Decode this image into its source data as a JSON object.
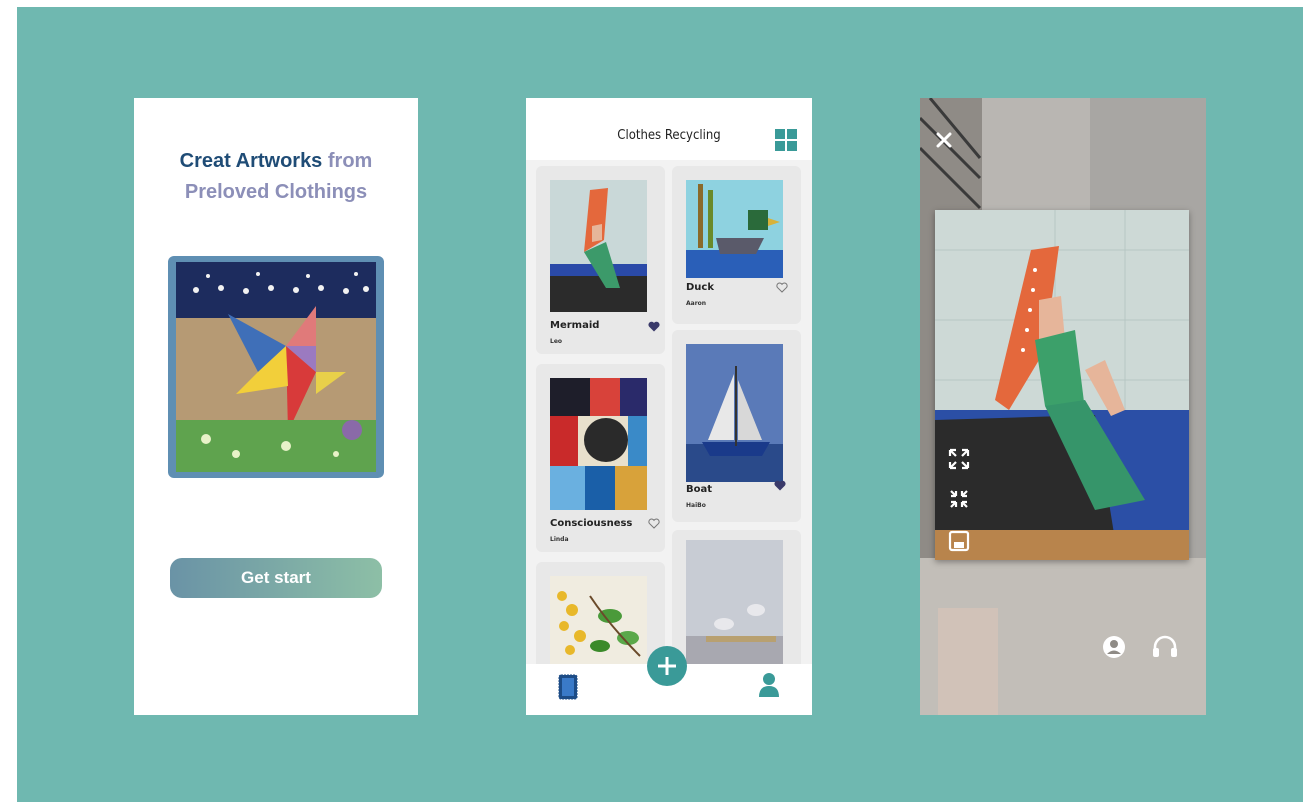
{
  "onboarding": {
    "headline_part1": "Creat Artworks",
    "headline_part2": "from",
    "headline_line2": "Preloved Clothings",
    "cta_label": "Get start"
  },
  "gallery": {
    "title": "Clothes Recycling",
    "cards": [
      {
        "title": "Mermaid",
        "author": "Leo",
        "liked": true
      },
      {
        "title": "Duck",
        "author": "Aaron",
        "liked": false
      },
      {
        "title": "Consciousness",
        "author": "Linda",
        "liked": false
      },
      {
        "title": "Boat",
        "author": "HaiBo",
        "liked": true
      }
    ],
    "nav": {
      "left_icon": "gallery-icon",
      "center_icon": "add-icon",
      "right_icon": "profile-icon"
    }
  },
  "ar_view": {
    "close_icon": "close-icon",
    "controls": [
      "expand-icon",
      "collapse-icon",
      "save-icon"
    ],
    "bottom_icons": [
      "profile-icon",
      "headphones-icon"
    ]
  },
  "colors": {
    "background": "#6fb8b0",
    "headline_dark": "#1f4c76",
    "headline_light": "#8c8fb8",
    "accent": "#3a9a98",
    "heart": "#3a3a6a"
  }
}
